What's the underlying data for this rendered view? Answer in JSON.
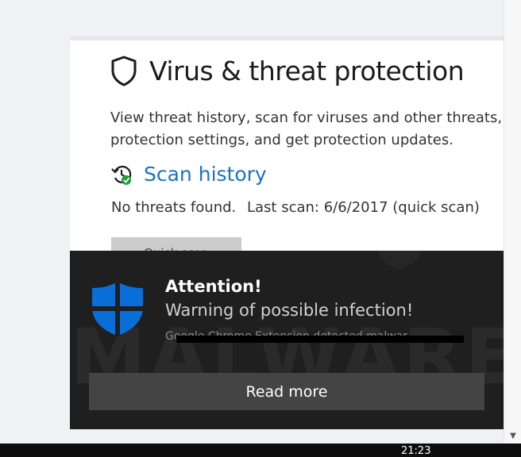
{
  "panel": {
    "title": "Virus & threat protection",
    "description_line1": "View threat history, scan for viruses and other threats, s",
    "description_line2": "protection settings, and get protection updates.",
    "scan_history_label": "Scan history",
    "status_no_threats": "No threats found.",
    "status_last_scan": "Last scan: 6/6/2017 (quick scan)",
    "quick_scan_label": "Quick scan"
  },
  "toast": {
    "title": "Attention!",
    "subtitle": "Warning of possible infection!",
    "redacted_text": "Google Chrome Extension detected malwar",
    "watermark": "MALWARE",
    "read_more_label": "Read more"
  },
  "taskbar": {
    "clock_time": "21:23"
  },
  "colors": {
    "link_blue": "#1a73c8",
    "shield_blue": "#0a6ed8",
    "toast_bg": "#1f1f1f",
    "check_green": "#1f9d3a"
  },
  "icons": [
    "shield-outline-icon",
    "scan-history-icon",
    "defender-shield-icon",
    "scroll-down-icon"
  ]
}
